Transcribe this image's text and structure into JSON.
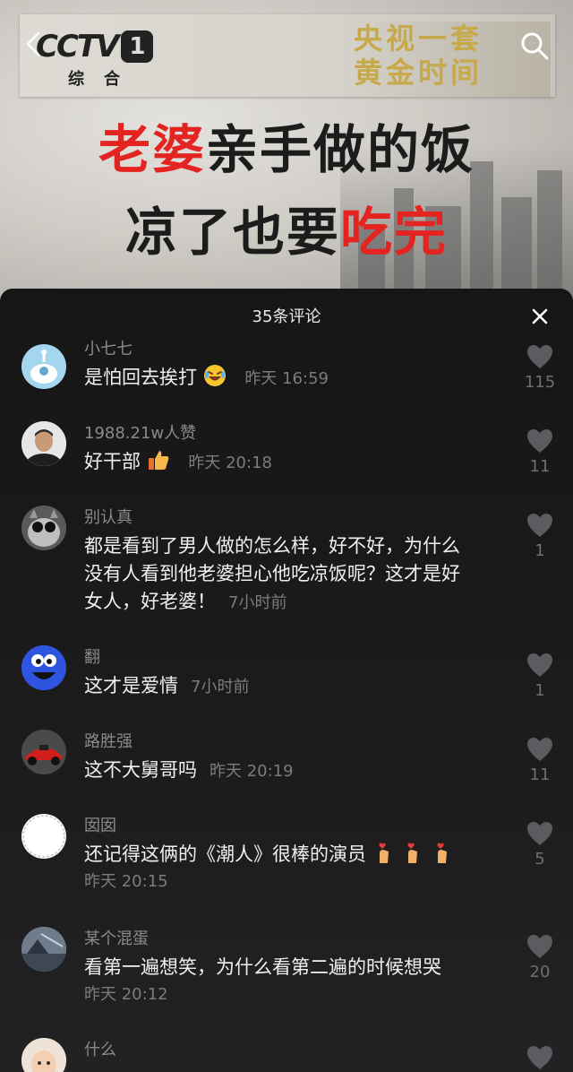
{
  "video": {
    "channel_logo": "CCTV",
    "channel_number": "1",
    "channel_sub": "综合",
    "banner_line1": "央视一套",
    "banner_line2": "黄金时间",
    "title_line1_red": "老婆",
    "title_line1_rest": "亲手做的饭",
    "title_line2_rest": "凉了也要",
    "title_line2_red": "吃完",
    "back_icon": "chevron-left-icon",
    "search_icon": "search-icon"
  },
  "comments_panel": {
    "count_label": "35条评论",
    "close_icon": "close-icon"
  },
  "comments": [
    {
      "user": "小七七",
      "text": "是怕回去挨打",
      "emoji": "laugh-cry-emoji",
      "time": "昨天 16:59",
      "likes": "115"
    },
    {
      "user": "1988.21w人赞",
      "text": "好干部",
      "emoji": "thumbs-up-emoji",
      "time": "昨天 20:18",
      "likes": "11"
    },
    {
      "user": "别认真",
      "text_lines": [
        "都是看到了男人做的怎么样，好不好，为什么",
        "没有人看到他老婆担心他吃凉饭呢？这才是好",
        "女人，好老婆！"
      ],
      "time": "7小时前",
      "likes": "1"
    },
    {
      "user": "翻",
      "text": "这才是爱情",
      "time": "7小时前",
      "likes": "1"
    },
    {
      "user": "路胜强",
      "text": "这不大舅哥吗",
      "time": "昨天 20:19",
      "likes": "11"
    },
    {
      "user": "囡囡",
      "text": "还记得这俩的《潮人》很棒的演员",
      "emoji": "finger-heart-emoji",
      "time": "昨天 20:15",
      "likes": "5"
    },
    {
      "user": "某个混蛋",
      "text": "看第一遍想笑，为什么看第二遍的时候想哭",
      "time": "昨天 20:12",
      "likes": "20"
    },
    {
      "user": "什么",
      "text": "",
      "time": "",
      "likes": ""
    }
  ],
  "colors": {
    "accent_red": "#e32421",
    "panel_bg": "#1c1c1d",
    "gold": "#c7a94a"
  }
}
